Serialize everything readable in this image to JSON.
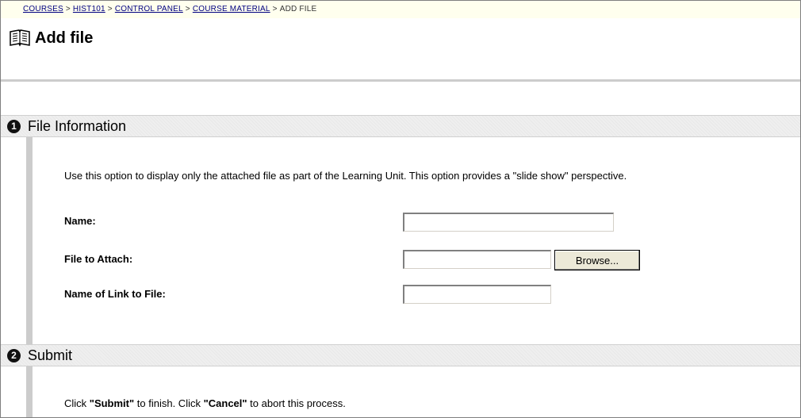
{
  "breadcrumb": {
    "items": [
      "COURSES",
      "HIST101",
      "CONTROL PANEL",
      "COURSE MATERIAL"
    ],
    "separator": ">",
    "current": "ADD FILE"
  },
  "page": {
    "title": "Add file",
    "icon": "book-icon"
  },
  "sections": [
    {
      "number": "1",
      "title": "File Information",
      "instructions": "Use this option to display only the attached file as part of the Learning Unit. This option provides a \"slide show\" perspective.",
      "fields": {
        "name": {
          "label": "Name:",
          "value": ""
        },
        "file": {
          "label": "File to Attach:",
          "value": "",
          "button": "Browse..."
        },
        "link_name": {
          "label": "Name of Link to File:",
          "value": ""
        }
      }
    },
    {
      "number": "2",
      "title": "Submit",
      "instructions_parts": [
        "Click ",
        "\"Submit\"",
        " to finish. Click ",
        "\"Cancel\"",
        " to abort this process."
      ]
    }
  ],
  "colors": {
    "breadcrumb_bg": "#ffffee",
    "link": "#000080",
    "section_bg": "#efefef",
    "bar": "#cccccc"
  }
}
